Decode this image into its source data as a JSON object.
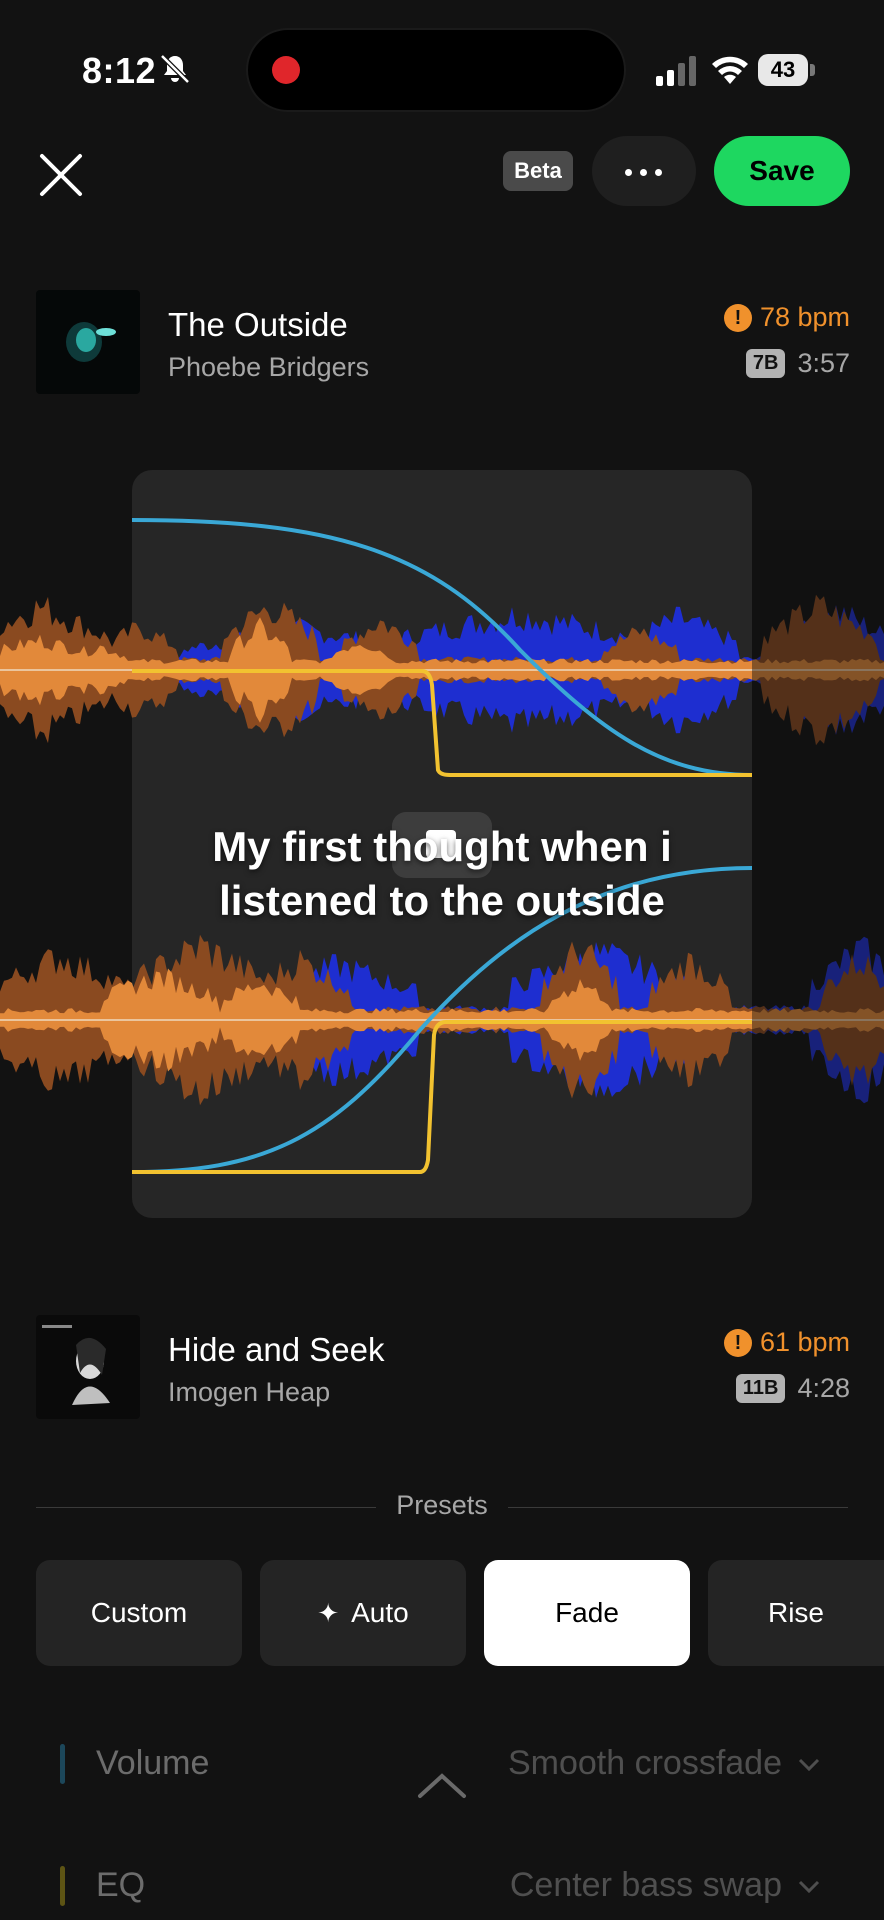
{
  "status_bar": {
    "time": "8:12",
    "battery": "43"
  },
  "top_bar": {
    "beta_label": "Beta",
    "save_label": "Save"
  },
  "tracks": [
    {
      "title": "The Outside",
      "artist": "Phoebe Bridgers",
      "bpm": "78 bpm",
      "key": "7B",
      "duration": "3:57"
    },
    {
      "title": "Hide and Seek",
      "artist": "Imogen Heap",
      "bpm": "61 bpm",
      "key": "11B",
      "duration": "4:28"
    }
  ],
  "caption": {
    "line1": "My first thought when i",
    "line2": "listened to the outside"
  },
  "presets": {
    "label": "Presets",
    "items": [
      {
        "label": "Custom"
      },
      {
        "label": "Auto"
      },
      {
        "label": "Fade"
      },
      {
        "label": "Rise"
      }
    ],
    "selected": "Fade"
  },
  "settings": [
    {
      "name": "Volume",
      "value": "Smooth crossfade",
      "color": "#2e9fd0"
    },
    {
      "name": "EQ",
      "value": "Center bass swap",
      "color": "#d8c018"
    }
  ],
  "colors": {
    "accent": "#1ed760",
    "warning": "#f0912c",
    "volume_curve": "#3aa8d6",
    "eq_curve": "#f2c230",
    "wave_low": "#1e2ed0",
    "wave_mid": "#8a4a20",
    "wave_high": "#e2893a"
  }
}
